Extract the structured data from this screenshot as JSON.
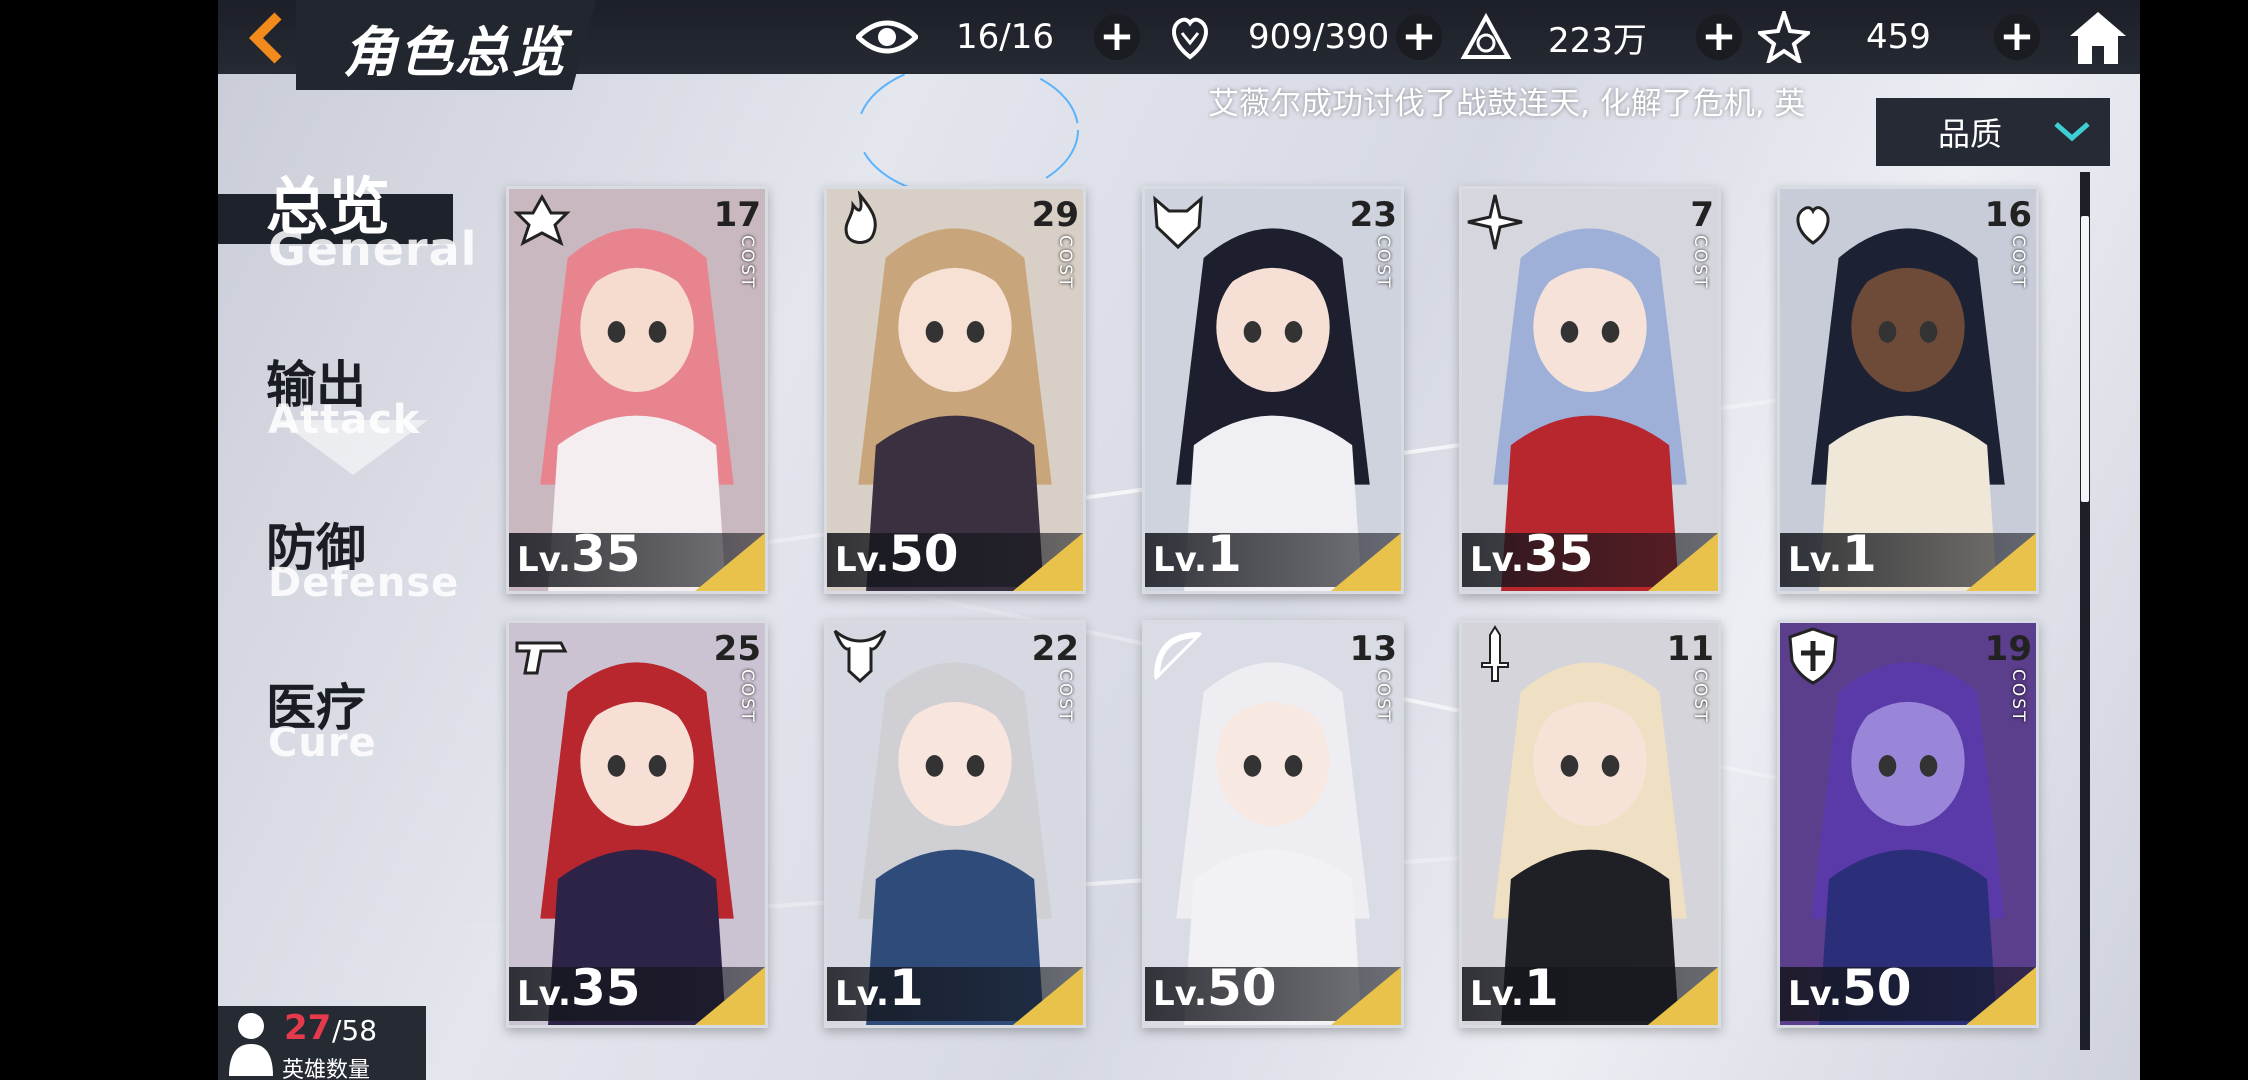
{
  "header": {
    "title": "角色总览",
    "resources": [
      {
        "id": "eye",
        "icon": "eye-icon",
        "value": "16/16"
      },
      {
        "id": "stamina",
        "icon": "heart-hand-icon",
        "value": "909/390"
      },
      {
        "id": "gold",
        "icon": "pyramid-coin-icon",
        "value": "223万"
      },
      {
        "id": "gem",
        "icon": "star-crystal-icon",
        "value": "459"
      }
    ]
  },
  "ticker": "艾薇尔成功讨伐了战鼓连天, 化解了危机, 英",
  "sort": {
    "label": "品质"
  },
  "categories": [
    {
      "cn": "总览",
      "en": "General"
    },
    {
      "cn": "输出",
      "en": "Attack"
    },
    {
      "cn": "防御",
      "en": "Defense"
    },
    {
      "cn": "医疗",
      "en": "Cure"
    }
  ],
  "cost_label": "COST",
  "lv_prefix": "Lv.",
  "cards": [
    {
      "cost": "17",
      "level": "35",
      "role_icon": "emblem-icon",
      "hair": "#e8848e",
      "outfit": "#f4eef0",
      "bg": "#c9b8c0",
      "skin": "#f6dccf"
    },
    {
      "cost": "29",
      "level": "50",
      "role_icon": "flame-icon",
      "hair": "#c9a57c",
      "outfit": "#3a3040",
      "bg": "#d8cfc6",
      "skin": "#f7e0d4"
    },
    {
      "cost": "23",
      "level": "1",
      "role_icon": "fox-mask-icon",
      "hair": "#1e1f2e",
      "outfit": "#efeff4",
      "bg": "#cfd3de",
      "skin": "#f6e0d6"
    },
    {
      "cost": "7",
      "level": "35",
      "role_icon": "shuriken-icon",
      "hair": "#9fb0d8",
      "outfit": "#b8262e",
      "bg": "#d6d7de",
      "skin": "#f7e2da"
    },
    {
      "cost": "16",
      "level": "1",
      "role_icon": "heart-wings-icon",
      "hair": "#1c2233",
      "outfit": "#efe8d8",
      "bg": "#c8ccd8",
      "skin": "#6e4a38"
    },
    {
      "cost": "25",
      "level": "35",
      "role_icon": "gun-icon",
      "hair": "#b8262e",
      "outfit": "#2c2346",
      "bg": "#cbc3d2",
      "skin": "#f7dfd5"
    },
    {
      "cost": "22",
      "level": "1",
      "role_icon": "horned-helmet-icon",
      "hair": "#cfcfd4",
      "outfit": "#2f4b7a",
      "bg": "#d6d9e2",
      "skin": "#f8e6de"
    },
    {
      "cost": "13",
      "level": "50",
      "role_icon": "bow-icon",
      "hair": "#eeeef2",
      "outfit": "#f2f2f4",
      "bg": "#d9dce4",
      "skin": "#f8e8e2"
    },
    {
      "cost": "11",
      "level": "1",
      "role_icon": "dagger-icon",
      "hair": "#efe0c4",
      "outfit": "#1f2026",
      "bg": "#d4d4da",
      "skin": "#f7e2d8"
    },
    {
      "cost": "19",
      "level": "50",
      "role_icon": "shield-cross-icon",
      "hair": "#5a3aa8",
      "outfit": "#2b2f7a",
      "bg": "#5b3e8c",
      "skin": "#9a86d8"
    }
  ],
  "hero_count": {
    "current": "27",
    "total": "/58",
    "label": "英雄数量"
  },
  "colors": {
    "accent": "#e8c24a",
    "dark": "#22262f",
    "back_arrow": "#f28a1c",
    "count_red": "#e53a4c"
  }
}
